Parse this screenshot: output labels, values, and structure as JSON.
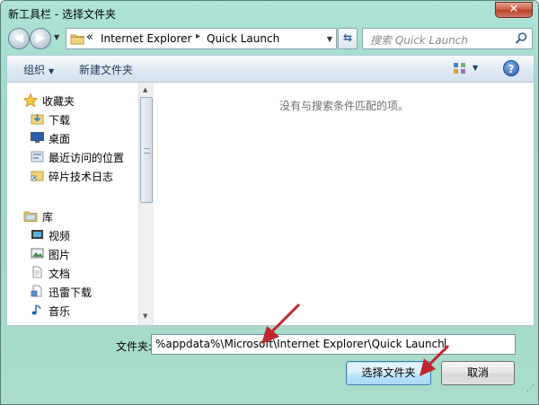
{
  "window": {
    "title": "新工具栏 - 选择文件夹",
    "close_glyph": "✕"
  },
  "address": {
    "overflow_glyph": "«",
    "crumbs": [
      "Internet Explorer",
      "Quick Launch"
    ],
    "separator_glyph": "▸"
  },
  "search": {
    "placeholder": "搜索 Quick Launch"
  },
  "toolbar": {
    "organize_label": "组织",
    "new_folder_label": "新建文件夹",
    "help_glyph": "?"
  },
  "nav": {
    "favorites": {
      "label": "收藏夹",
      "items": [
        {
          "label": "下载",
          "icon": "download-folder-icon"
        },
        {
          "label": "桌面",
          "icon": "desktop-icon"
        },
        {
          "label": "最近访问的位置",
          "icon": "recent-places-icon"
        },
        {
          "label": "碎片技术日志",
          "icon": "shortcut-folder-icon"
        }
      ]
    },
    "libraries": {
      "label": "库",
      "items": [
        {
          "label": "视频",
          "icon": "video-library-icon"
        },
        {
          "label": "图片",
          "icon": "pictures-library-icon"
        },
        {
          "label": "文档",
          "icon": "documents-library-icon"
        },
        {
          "label": "迅雷下载",
          "icon": "thunder-download-icon"
        },
        {
          "label": "音乐",
          "icon": "music-library-icon"
        }
      ]
    }
  },
  "content": {
    "empty_message": "没有与搜索条件匹配的项。"
  },
  "footer": {
    "folder_label": "文件夹:",
    "folder_value": "%appdata%\\Microsoft\\Internet Explorer\\Quick Launch",
    "select_button": "选择文件夹",
    "cancel_button": "取消"
  },
  "colors": {
    "frame": "#a9dccb",
    "annotation_arrow": "#c0262d",
    "primary_button_border": "#3c7fb1"
  }
}
